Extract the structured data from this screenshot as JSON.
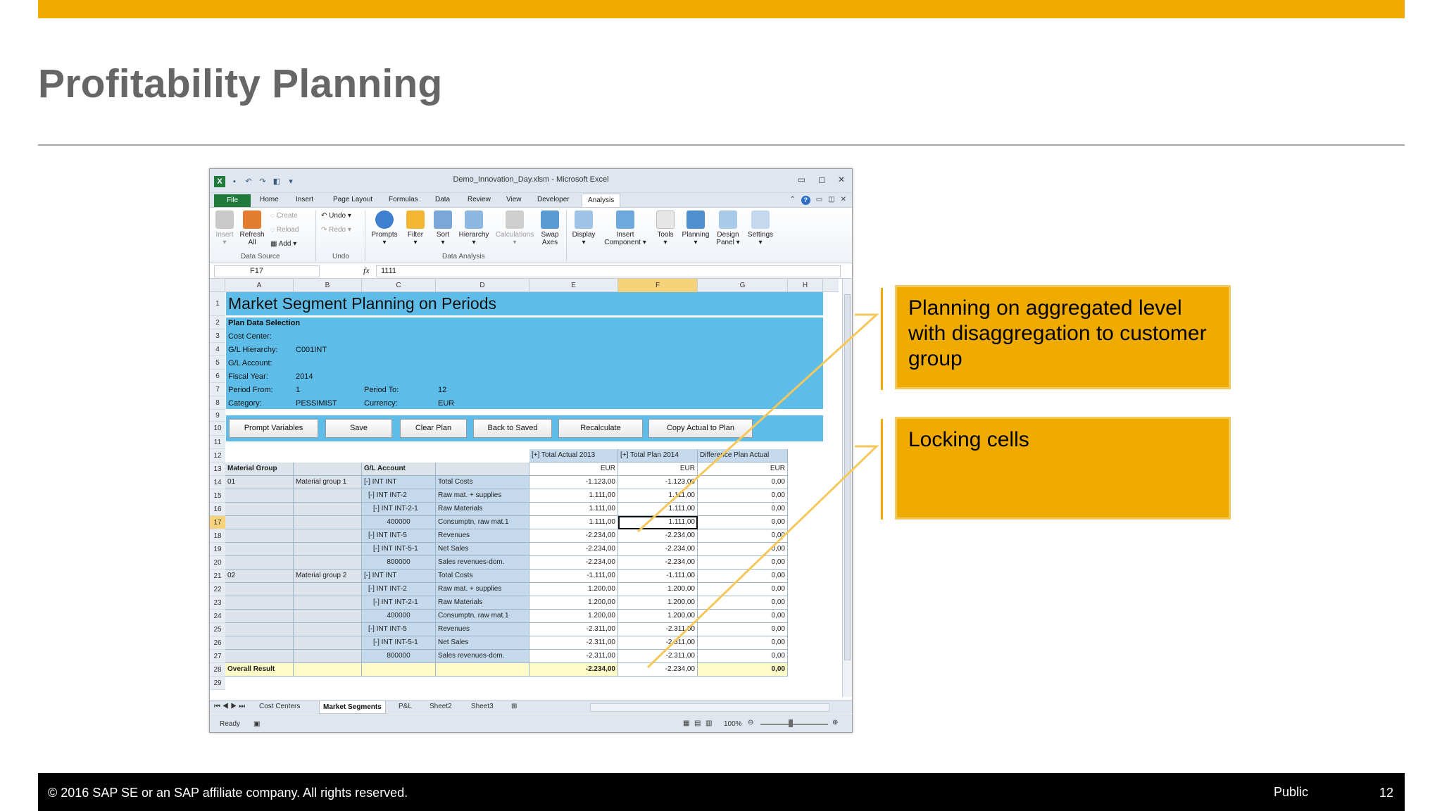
{
  "slide": {
    "title": "Profitability Planning",
    "footer_copyright": "© 2016 SAP SE or an SAP affiliate company. All rights reserved.",
    "classification": "Public",
    "page_number": "12",
    "accent_color": "#f0ab00"
  },
  "callouts": [
    {
      "text": "Planning on aggregated level with disaggregation to customer group"
    },
    {
      "text": "Locking cells"
    }
  ],
  "excel": {
    "window_title": "Demo_Innovation_Day.xlsm - Microsoft Excel",
    "ribbon_tabs": [
      "File",
      "Home",
      "Insert",
      "Page Layout",
      "Formulas",
      "Data",
      "Review",
      "View",
      "Developer",
      "Analysis"
    ],
    "active_tab": "Analysis",
    "ribbon": {
      "insert": "Insert",
      "refresh": "Refresh",
      "refresh_all": "All",
      "create": "Create",
      "reload": "Reload",
      "add": "Add",
      "group_data_source": "Data Source",
      "undo": "Undo",
      "redo": "Redo",
      "group_undo": "Undo",
      "prompts": "Prompts",
      "filter": "Filter",
      "sort": "Sort",
      "hierarchy": "Hierarchy",
      "calculations": "Calculations",
      "swap": "Swap",
      "axes": "Axes",
      "group_data_analysis": "Data Analysis",
      "display": "Display",
      "insert_component_1": "Insert",
      "insert_component_2": "Component",
      "tools": "Tools",
      "planning": "Planning",
      "design": "Design",
      "panel": "Panel",
      "settings": "Settings"
    },
    "name_box": "F17",
    "fx_symbol": "fx",
    "formula_value": "1111",
    "columns": [
      "A",
      "B",
      "C",
      "D",
      "E",
      "F",
      "G",
      "H"
    ],
    "selected_column": "F",
    "selected_row": "17",
    "sheet_title": "Market Segment Planning on Periods",
    "selection": {
      "heading": "Plan Data Selection",
      "cost_center_label": "Cost Center:",
      "gl_hierarchy_label": "G/L Hierarchy:",
      "gl_hierarchy_value": "C001INT",
      "gl_account_label": "G/L Account:",
      "fiscal_year_label": "Fiscal Year:",
      "fiscal_year_value": "2014",
      "period_from_label": "Period From:",
      "period_from_value": "1",
      "period_to_label": "Period To:",
      "period_to_value": "12",
      "category_label": "Category:",
      "category_value": "PESSIMIST",
      "currency_label": "Currency:",
      "currency_value": "EUR"
    },
    "buttons": [
      "Prompt Variables",
      "Save",
      "Clear Plan",
      "Back to Saved",
      "Recalculate",
      "Copy Actual to Plan"
    ],
    "table": {
      "measure_headers": [
        "[+] Total Actual 2013",
        "[+] Total Plan 2014",
        "Difference Plan Actual"
      ],
      "dim_headers": [
        "Material Group",
        "",
        "G/L Account",
        ""
      ],
      "unit_headers": [
        "EUR",
        "EUR",
        "EUR"
      ],
      "rows": [
        {
          "rn": "14",
          "mg": "01",
          "mgt": "Material group 1",
          "gl": "[-] INT INT",
          "glt": "Total Costs",
          "a": "-1.123,00",
          "p": "-1.123,00",
          "d": "0,00"
        },
        {
          "rn": "15",
          "mg": "",
          "mgt": "",
          "gl": "[-] INT INT-2",
          "glt": "Raw mat. + supplies",
          "a": "1.111,00",
          "p": "1.111,00",
          "d": "0,00"
        },
        {
          "rn": "16",
          "mg": "",
          "mgt": "",
          "gl": "[-] INT INT-2-1",
          "glt": "Raw Materials",
          "a": "1.111,00",
          "p": "1.111,00",
          "d": "0,00"
        },
        {
          "rn": "17",
          "mg": "",
          "mgt": "",
          "gl": "400000",
          "glt": "Consumptn, raw mat.1",
          "a": "1.111,00",
          "p": "1.111,00",
          "d": "0,00"
        },
        {
          "rn": "18",
          "mg": "",
          "mgt": "",
          "gl": "[-] INT INT-5",
          "glt": "Revenues",
          "a": "-2.234,00",
          "p": "-2.234,00",
          "d": "0,00"
        },
        {
          "rn": "19",
          "mg": "",
          "mgt": "",
          "gl": "[-] INT INT-5-1",
          "glt": "Net Sales",
          "a": "-2.234,00",
          "p": "-2.234,00",
          "d": "0,00"
        },
        {
          "rn": "20",
          "mg": "",
          "mgt": "",
          "gl": "800000",
          "glt": "Sales revenues-dom.",
          "a": "-2.234,00",
          "p": "-2.234,00",
          "d": "0,00"
        },
        {
          "rn": "21",
          "mg": "02",
          "mgt": "Material group 2",
          "gl": "[-] INT INT",
          "glt": "Total Costs",
          "a": "-1.111,00",
          "p": "-1.111,00",
          "d": "0,00"
        },
        {
          "rn": "22",
          "mg": "",
          "mgt": "",
          "gl": "[-] INT INT-2",
          "glt": "Raw mat. + supplies",
          "a": "1.200,00",
          "p": "1.200,00",
          "d": "0,00"
        },
        {
          "rn": "23",
          "mg": "",
          "mgt": "",
          "gl": "[-] INT INT-2-1",
          "glt": "Raw Materials",
          "a": "1.200,00",
          "p": "1.200,00",
          "d": "0,00"
        },
        {
          "rn": "24",
          "mg": "",
          "mgt": "",
          "gl": "400000",
          "glt": "Consumptn, raw mat.1",
          "a": "1.200,00",
          "p": "1.200,00",
          "d": "0,00"
        },
        {
          "rn": "25",
          "mg": "",
          "mgt": "",
          "gl": "[-] INT INT-5",
          "glt": "Revenues",
          "a": "-2.311,00",
          "p": "-2.311,00",
          "d": "0,00"
        },
        {
          "rn": "26",
          "mg": "",
          "mgt": "",
          "gl": "[-] INT INT-5-1",
          "glt": "Net Sales",
          "a": "-2.311,00",
          "p": "-2.311,00",
          "d": "0,00"
        },
        {
          "rn": "27",
          "mg": "",
          "mgt": "",
          "gl": "800000",
          "glt": "Sales revenues-dom.",
          "a": "-2.311,00",
          "p": "-2.311,00",
          "d": "0,00"
        }
      ],
      "overall": {
        "rn": "28",
        "label": "Overall Result",
        "a": "-2.234,00",
        "p": "-2.234,00",
        "d": "0,00"
      }
    },
    "sheet_tabs": [
      "Cost Centers",
      "Market Segments",
      "P&L",
      "Sheet2",
      "Sheet3"
    ],
    "active_sheet": "Market Segments",
    "status_text": "Ready",
    "zoom": "100%"
  }
}
